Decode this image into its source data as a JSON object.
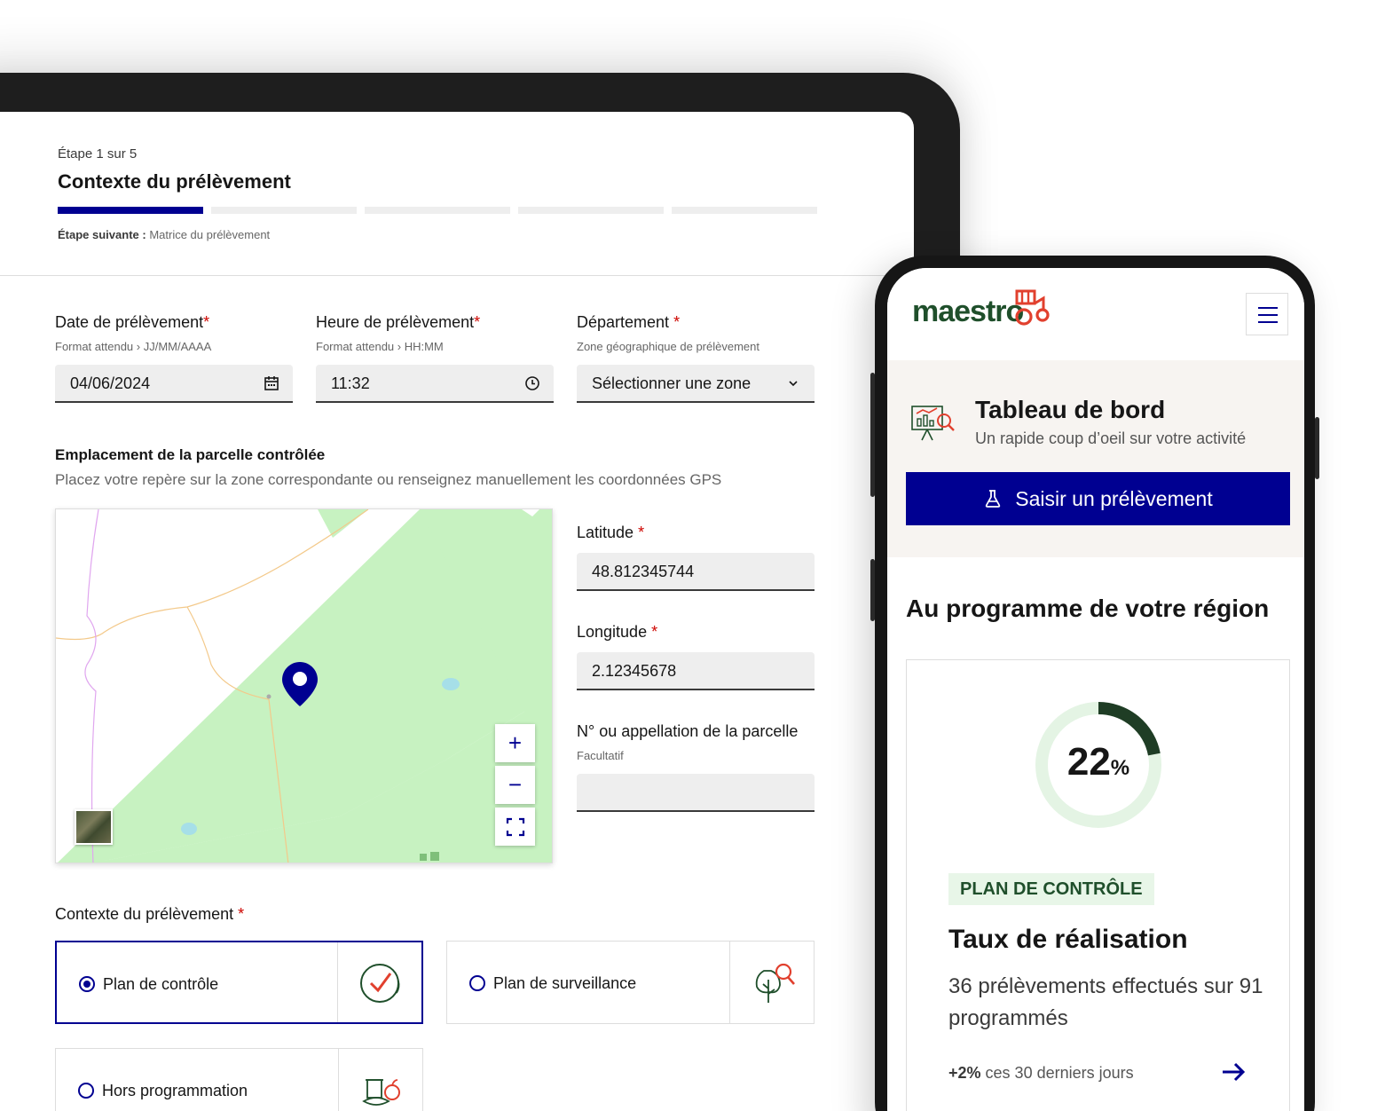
{
  "form": {
    "step_count": "Étape 1 sur 5",
    "step_title": "Contexte du prélèvement",
    "step_total": 5,
    "step_current": 1,
    "next_label": "Étape suivante :",
    "next_value": "Matrice du prélèvement",
    "date": {
      "label": "Date de prélèvement",
      "required": "*",
      "hint": "Format attendu › JJ/MM/AAAA",
      "value": "04/06/2024",
      "icon": "calendar-icon"
    },
    "time": {
      "label": "Heure de prélèvement",
      "required": "*",
      "hint": "Format attendu › HH:MM",
      "value": "11:32",
      "icon": "clock-icon"
    },
    "department": {
      "label": "Département",
      "required": "*",
      "hint": "Zone géographique de prélèvement",
      "value": "Sélectionner une zone",
      "icon": "chevron-down-icon"
    },
    "location": {
      "title": "Emplacement de la parcelle contrôlée",
      "description": "Placez votre repère sur la zone correspondante ou renseignez manuellement les coordonnées GPS"
    },
    "map": {
      "zoom_in": "+",
      "zoom_out": "−",
      "marker_icon": "map-pin-icon",
      "fullscreen_icon": "fullscreen-icon",
      "field_color": "#c7f2c1",
      "marker_color": "#000091"
    },
    "latitude": {
      "label": "Latitude",
      "required": "*",
      "value": "48.812345744"
    },
    "longitude": {
      "label": "Longitude",
      "required": "*",
      "value": "2.12345678"
    },
    "parcel": {
      "label": "N° ou appellation de la parcelle",
      "hint": "Facultatif",
      "value": ""
    },
    "context": {
      "label": "Contexte du prélèvement",
      "required": "*",
      "options": [
        {
          "label": "Plan de contrôle",
          "checked": true,
          "icon": "check-circle-icon"
        },
        {
          "label": "Plan de surveillance",
          "checked": false,
          "icon": "tree-search-icon"
        },
        {
          "label": "Hors programmation",
          "checked": false,
          "icon": "produce-icon"
        }
      ]
    }
  },
  "mobile": {
    "logo": "maestro",
    "menu_icon": "hamburger-menu-icon",
    "dashboard": {
      "title": "Tableau de bord",
      "subtitle": "Un rapide coup d’oeil sur votre activité",
      "icon": "dashboard-chart-icon"
    },
    "cta_label": "Saisir un prélèvement",
    "cta_icon": "sample-flask-icon",
    "region_title": "Au programme de votre région",
    "card": {
      "percent": "22",
      "percent_unit": "%",
      "progress": 0.22,
      "badge": "PLAN DE CONTRÔLE",
      "title": "Taux de réalisation",
      "description": "36 prélèvements effectués sur 91 programmés",
      "trend_value": "+2%",
      "trend_text": "ces 30 derniers jours",
      "arrow_icon": "arrow-right-icon"
    }
  },
  "colors": {
    "primary": "#000091",
    "brand_green": "#1f4f2b",
    "required": "#ce0500",
    "dashboard_bg": "#f7f4f1",
    "badge_bg": "#e8f6e8",
    "donut_track": "#e4f4e4",
    "donut_fill": "#1f3d25"
  }
}
